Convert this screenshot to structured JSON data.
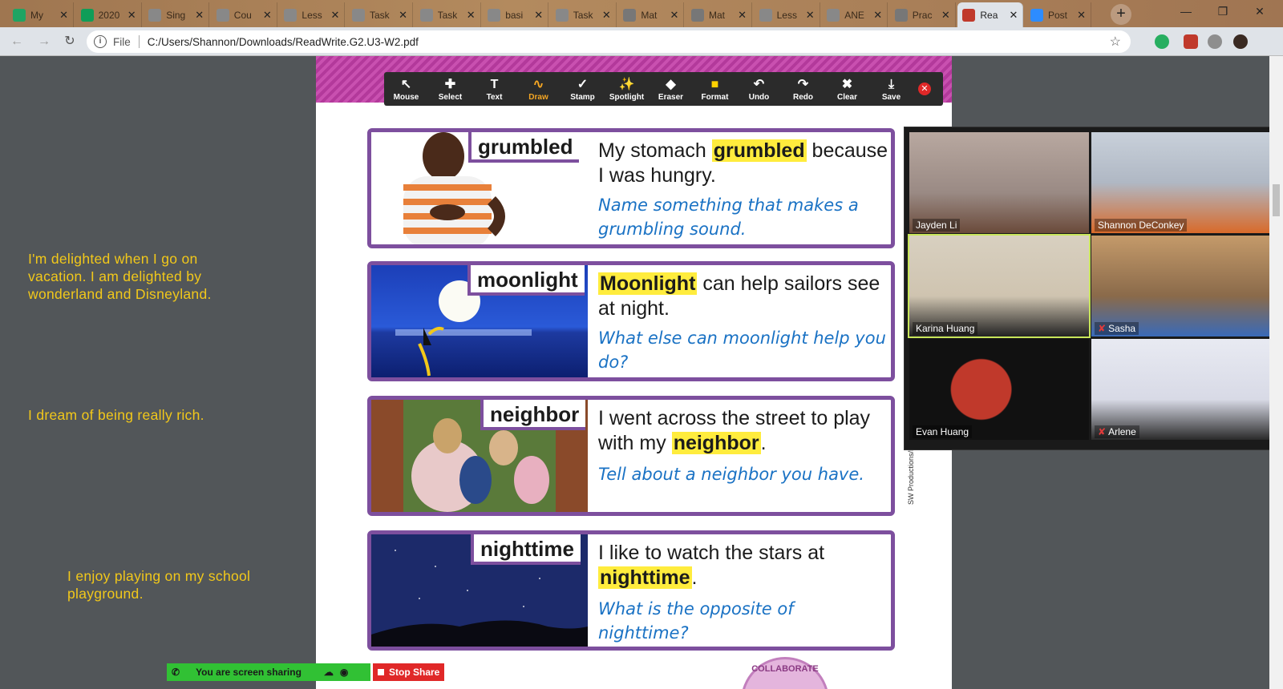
{
  "tabs": [
    {
      "title": "My",
      "icon": "drive-icon",
      "color": "#1fa463"
    },
    {
      "title": "2020",
      "icon": "sheets-icon",
      "color": "#0f9d58"
    },
    {
      "title": "Sing",
      "icon": "doc-icon",
      "color": "#888888"
    },
    {
      "title": "Cou",
      "icon": "doc-icon",
      "color": "#888888"
    },
    {
      "title": "Less",
      "icon": "doc-icon",
      "color": "#888888"
    },
    {
      "title": "Task",
      "icon": "doc-icon",
      "color": "#888888"
    },
    {
      "title": "Task",
      "icon": "doc-icon",
      "color": "#888888"
    },
    {
      "title": "basi",
      "icon": "doc-icon",
      "color": "#888888"
    },
    {
      "title": "Task",
      "icon": "doc-icon",
      "color": "#888888"
    },
    {
      "title": "Mat",
      "icon": "globe-icon",
      "color": "#777777"
    },
    {
      "title": "Mat",
      "icon": "globe-icon",
      "color": "#777777"
    },
    {
      "title": "Less",
      "icon": "doc-icon",
      "color": "#888888"
    },
    {
      "title": "ANE",
      "icon": "doc-icon",
      "color": "#888888"
    },
    {
      "title": "Prac",
      "icon": "globe-icon",
      "color": "#777777"
    },
    {
      "title": "Rea",
      "icon": "pdf-icon",
      "color": "#c0392b"
    },
    {
      "title": "Post",
      "icon": "zoom-icon",
      "color": "#2d8cff"
    }
  ],
  "address": {
    "scheme_label": "File",
    "url": "C:/Users/Shannon/Downloads/ReadWrite.G2.U3-W2.pdf"
  },
  "notes": [
    "I'm delighted when I go on vacation. I am delighted by wonderland and Disneyland.",
    "I dream of being really rich.",
    "I enjoy playing on my school playground."
  ],
  "annotation_toolbar": [
    {
      "label": "Mouse",
      "icon": "mouse-pointer-icon"
    },
    {
      "label": "Select",
      "icon": "move-icon"
    },
    {
      "label": "Text",
      "icon": "text-icon"
    },
    {
      "label": "Draw",
      "icon": "draw-icon"
    },
    {
      "label": "Stamp",
      "icon": "stamp-icon"
    },
    {
      "label": "Spotlight",
      "icon": "spotlight-icon"
    },
    {
      "label": "Eraser",
      "icon": "eraser-icon"
    },
    {
      "label": "Format",
      "icon": "format-icon"
    },
    {
      "label": "Undo",
      "icon": "undo-icon"
    },
    {
      "label": "Redo",
      "icon": "redo-icon"
    },
    {
      "label": "Clear",
      "icon": "trash-icon"
    },
    {
      "label": "Save",
      "icon": "save-icon"
    }
  ],
  "cards": [
    {
      "word": "grumbled",
      "sentence_before": "My stomach ",
      "sentence_hl": "grumbled",
      "sentence_after": " because I was hungry.",
      "prompt": "Name something that makes a grumbling sound."
    },
    {
      "word": "moonlight",
      "sentence_before": "",
      "sentence_hl": "Moonlight",
      "sentence_after": " can help sailors see at night.",
      "prompt": "What else can moonlight help you do?"
    },
    {
      "word": "neighbor",
      "sentence_before": "I went across the street to play with my ",
      "sentence_hl": "neighbor",
      "sentence_after": ".",
      "prompt": "Tell about a neighbor you have."
    },
    {
      "word": "nighttime",
      "sentence_before": "I like to watch the stars at ",
      "sentence_hl": "nighttime",
      "sentence_after": ".",
      "prompt": "What is the opposite of nighttime?"
    }
  ],
  "credit": "SW Productions/Brand X/Corbis; (b) UVimages/amanaimages/Corbis",
  "collab_label": "COLLABORATE",
  "participants": [
    {
      "name": "Jayden Li",
      "muted": false
    },
    {
      "name": "Shannon DeConkey",
      "muted": false
    },
    {
      "name": "Karina Huang",
      "muted": false
    },
    {
      "name": "Sasha",
      "muted": true
    },
    {
      "name": "Evan Huang",
      "muted": false
    },
    {
      "name": "Arlene",
      "muted": true
    }
  ],
  "share": {
    "status": "You are screen sharing",
    "stop_label": "Stop Share"
  }
}
